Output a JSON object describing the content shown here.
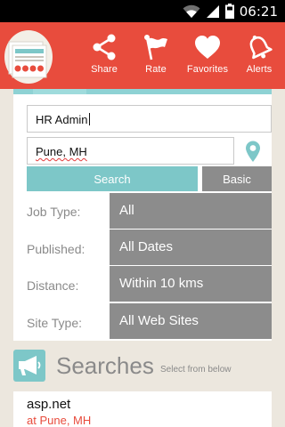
{
  "status_bar": {
    "time": "06:21",
    "icons": [
      "wifi-icon",
      "signal-icon",
      "battery-icon"
    ]
  },
  "action_bar": {
    "brand_color": "#e84c3d",
    "logo_icon": "newspaper-logo-icon",
    "actions": [
      {
        "label": "Share",
        "icon": "share-icon"
      },
      {
        "label": "Rate",
        "icon": "flag-icon"
      },
      {
        "label": "Favorites",
        "icon": "heart-icon"
      },
      {
        "label": "Alerts",
        "icon": "bell-icon"
      }
    ]
  },
  "search_form": {
    "keyword_value": "HR Admin",
    "location_value": "Pune, MH",
    "location_icon": "map-pin-icon",
    "search_label": "Search",
    "basic_label": "Basic",
    "accent_color": "#7dc7c8",
    "filters": [
      {
        "label": "Job Type:",
        "value": "All"
      },
      {
        "label": "Published:",
        "value": "All Dates"
      },
      {
        "label": "Distance:",
        "value": "Within 10 kms"
      },
      {
        "label": "Site Type:",
        "value": "All Web Sites"
      }
    ]
  },
  "searches": {
    "icon": "megaphone-icon",
    "title": "Searches",
    "subtitle": "Select from below",
    "items": [
      {
        "keyword": "asp.net",
        "location": "at Pune, MH"
      }
    ]
  }
}
